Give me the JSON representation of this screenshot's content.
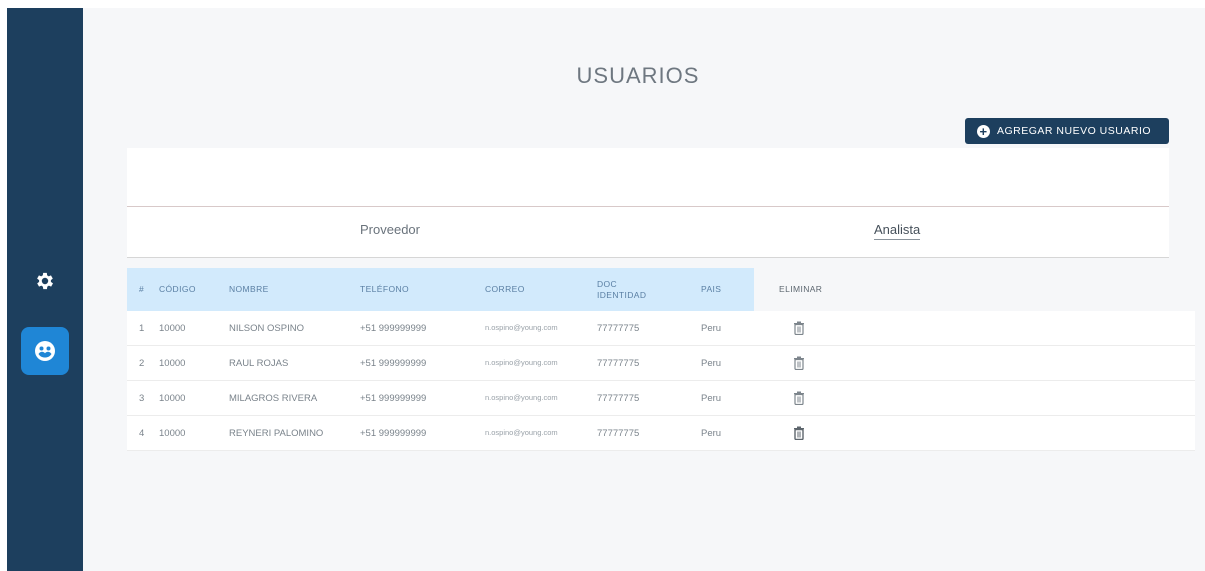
{
  "page": {
    "title": "USUARIOS"
  },
  "sidebar": {
    "items": [
      {
        "name": "settings",
        "icon": "gear-icon"
      },
      {
        "name": "users",
        "icon": "users-icon",
        "active": true
      }
    ]
  },
  "actions": {
    "add_user_label": "AGREGAR NUEVO USUARIO"
  },
  "tabs": [
    {
      "label": "Proveedor"
    },
    {
      "label": "Analista",
      "active": true
    }
  ],
  "table": {
    "columns": [
      "#",
      "CÓDIGO",
      "NOMBRE",
      "TELÉFONO",
      "CORREO",
      "DOC IDENTIDAD",
      "PAIS",
      "ELIMINAR"
    ],
    "rows": [
      {
        "index": "1",
        "code": "10000",
        "name": "NILSON OSPINO",
        "phone": "+51 999999999",
        "email": "n.ospino@young.com",
        "doc": "77777775",
        "country": "Peru"
      },
      {
        "index": "2",
        "code": "10000",
        "name": "RAUL ROJAS",
        "phone": "+51 999999999",
        "email": "n.ospino@young.com",
        "doc": "77777775",
        "country": "Peru"
      },
      {
        "index": "3",
        "code": "10000",
        "name": "MILAGROS RIVERA",
        "phone": "+51 999999999",
        "email": "n.ospino@young.com",
        "doc": "77777775",
        "country": "Peru"
      },
      {
        "index": "4",
        "code": "10000",
        "name": "REYNERI PALOMINO",
        "phone": "+51 999999999",
        "email": "n.ospino@young.com",
        "doc": "77777775",
        "country": "Peru"
      }
    ]
  },
  "colors": {
    "sidebar": "#1d3f5e",
    "active_nav": "#1f86d6",
    "header_row": "#d2eafc",
    "button": "#1d3f5e"
  }
}
